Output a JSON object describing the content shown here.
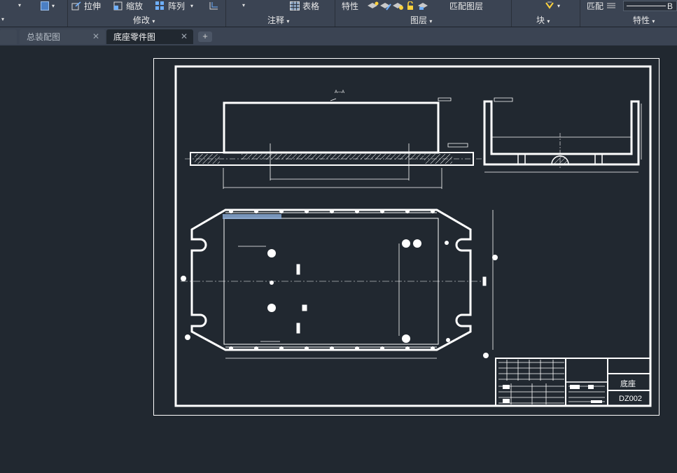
{
  "ribbon": {
    "tools": {
      "stretch": "拉伸",
      "scale": "缩放",
      "array": "阵列",
      "table": "表格",
      "properties": "特性",
      "match_layer": "匹配图层",
      "match": "匹配",
      "bylayer": "B"
    },
    "panels": {
      "modify": "修改",
      "annotation": "注释",
      "layers": "图层",
      "block": "块",
      "properties": "特性"
    }
  },
  "tabs": [
    {
      "label": "总装配图",
      "active": false
    },
    {
      "label": "底座零件图",
      "active": true
    }
  ],
  "drawing": {
    "section_label": "A—A",
    "title_block": {
      "part_name": "底座",
      "drawing_number": "DZ002"
    }
  },
  "colors": {
    "ribbon_bg": "#3b4453",
    "canvas_bg": "#212830",
    "line": "#ffffff"
  }
}
